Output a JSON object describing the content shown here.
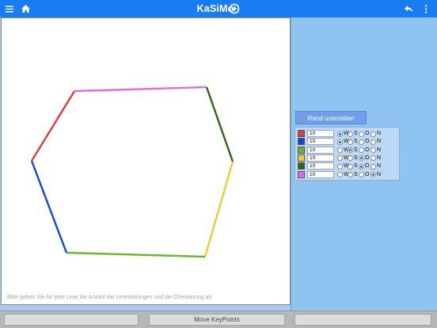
{
  "header": {
    "title": "KaSiMo",
    "icons": {
      "menu": "menu-icon",
      "home": "home-icon",
      "add": "add-circle-icon",
      "back": "back-arrow-icon",
      "more": "more-vertical-icon"
    }
  },
  "canvas": {
    "hint": "Bitte geben Sie für jede Linie die Anzahl der Unterteilungen und die Orientierung an",
    "colors": {
      "top": "#e06ce0",
      "upper_right": "#2f6419",
      "lower_right": "#efca33",
      "bottom": "#6ab82a",
      "lower_left": "#1144e0",
      "upper_left": "#e03a3a"
    }
  },
  "panel": {
    "rand_button": "Rand unterteilen",
    "option_labels": [
      "W",
      "S",
      "O",
      "N"
    ],
    "lines": [
      {
        "color": "#e03a3a",
        "count": "10",
        "selected": "W"
      },
      {
        "color": "#1144e0",
        "count": "10",
        "selected": "W"
      },
      {
        "color": "#6ab82a",
        "count": "10",
        "selected": "S"
      },
      {
        "color": "#efca33",
        "count": "10",
        "selected": "O"
      },
      {
        "color": "#2f6419",
        "count": "10",
        "selected": "O"
      },
      {
        "color": "#e06ce0",
        "count": "10",
        "selected": "N"
      }
    ]
  },
  "footer": {
    "left_button": "",
    "move_button": "Move KeyPoints",
    "right_button": ""
  }
}
